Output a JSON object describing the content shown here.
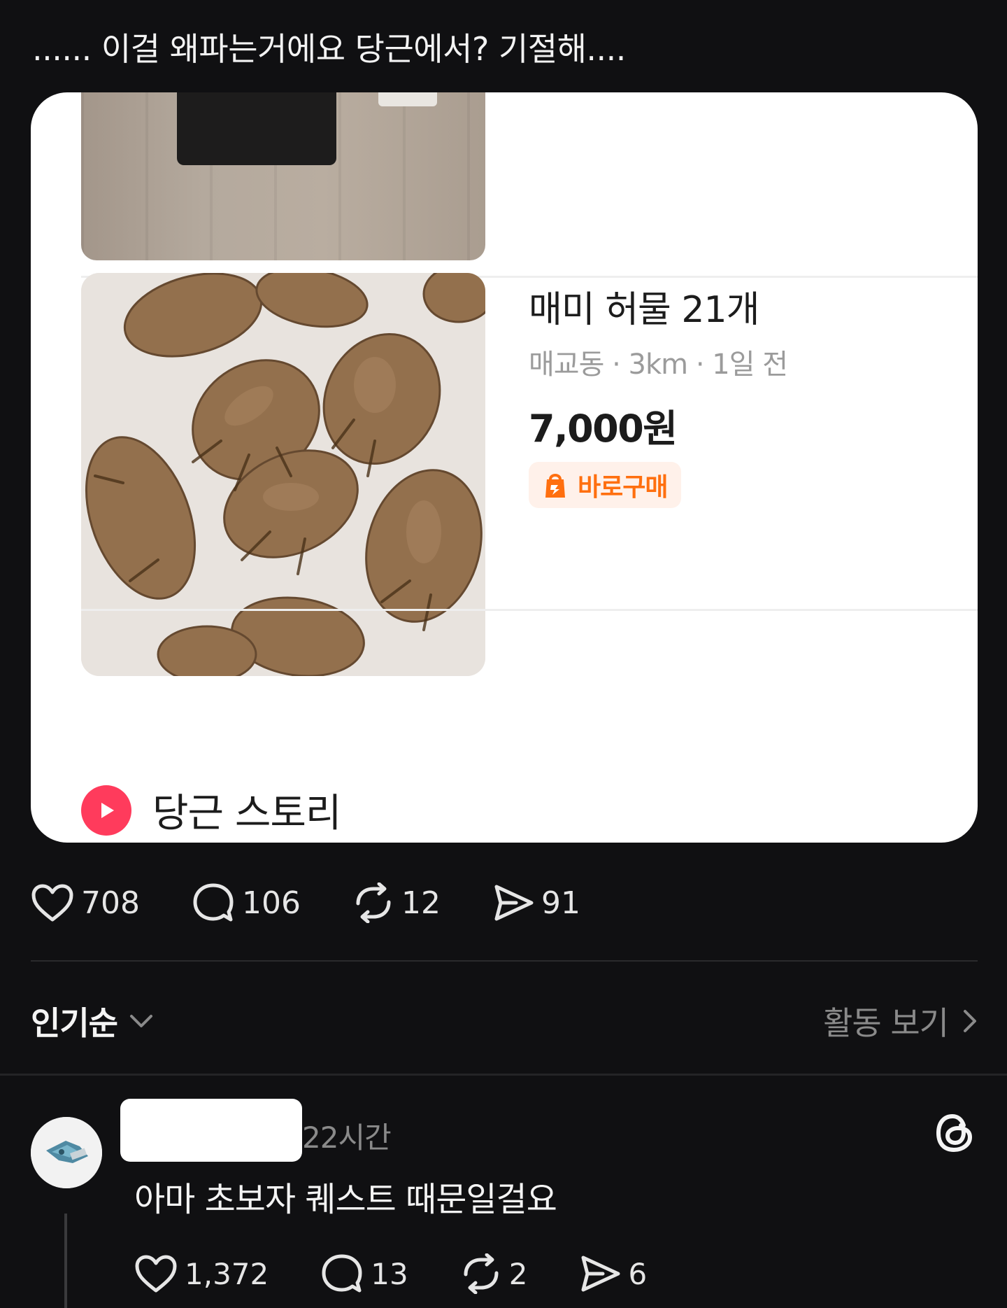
{
  "post": {
    "text": "...... 이걸 왜파는거에요 당근에서? 기절해...."
  },
  "listing": {
    "title": "매미 허물 21개",
    "meta": "매교동 · 3km · 1일 전",
    "price": "7,000원",
    "badge": "바로구매",
    "story_label": "당근 스토리"
  },
  "post_actions": {
    "likes": "708",
    "replies": "106",
    "reposts": "12",
    "shares": "91"
  },
  "sort": {
    "label": "인기순",
    "activity_link": "활동 보기"
  },
  "comment": {
    "time": "22시간",
    "text": "아마 초보자 퀘스트 때문일걸요",
    "actions": {
      "likes": "1,372",
      "replies": "13",
      "reposts": "2",
      "shares": "6"
    }
  },
  "colors": {
    "background": "#101012",
    "accent_orange": "#ff6f0f",
    "story_red": "#ff3b5c"
  }
}
